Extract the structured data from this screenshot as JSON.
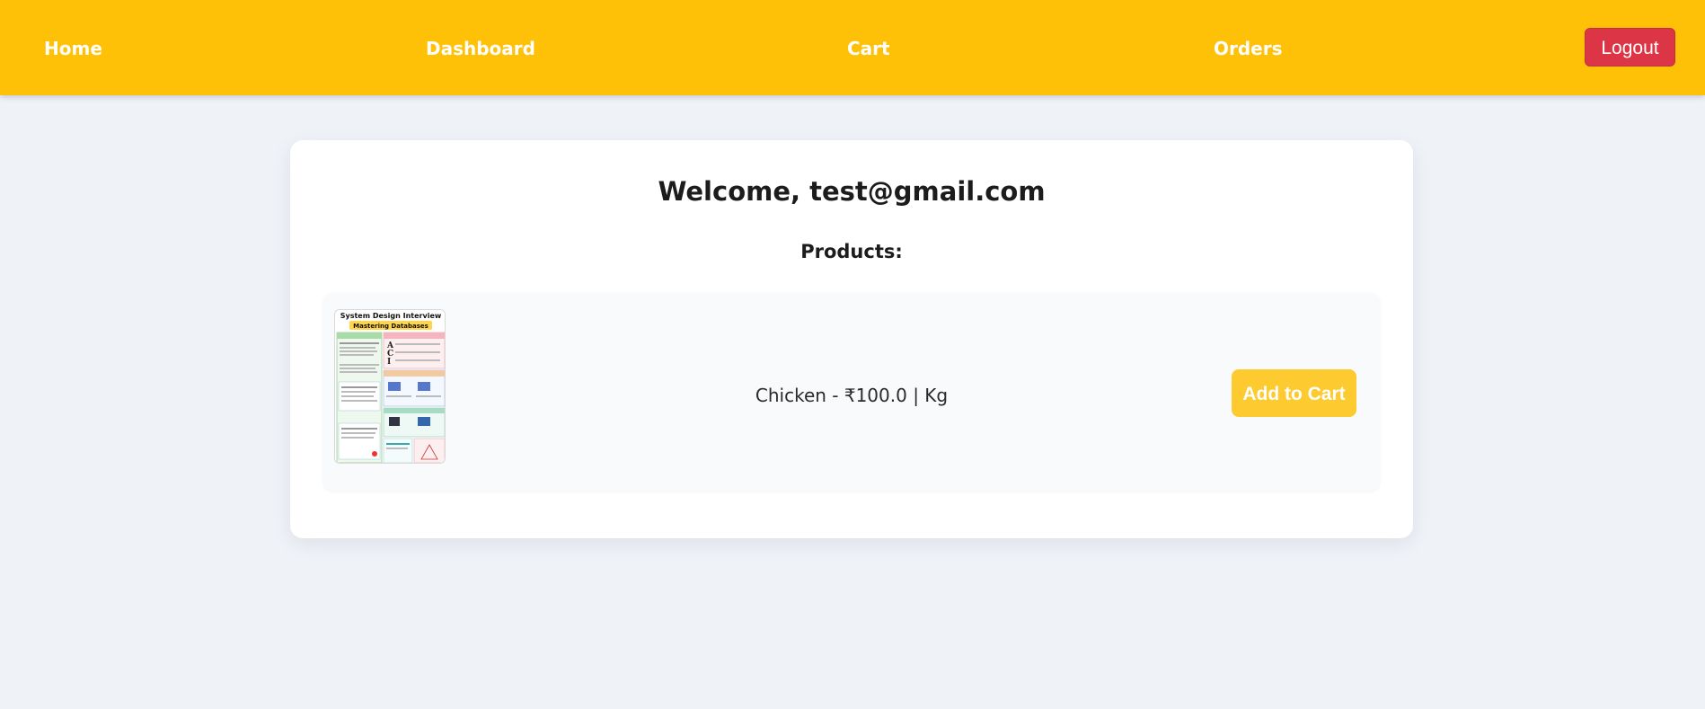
{
  "nav": {
    "home": "Home",
    "dashboard": "Dashboard",
    "cart": "Cart",
    "orders": "Orders",
    "logout": "Logout"
  },
  "main": {
    "welcome": "Welcome, test@gmail.com",
    "products_heading": "Products:"
  },
  "products": [
    {
      "name": "Chicken",
      "price": "₹100.0",
      "unit": "Kg",
      "add_button": "Add to Cart",
      "image_title": "System Design Interview",
      "image_subtitle": "Mastering Databases"
    }
  ],
  "colors": {
    "navbar": "#ffc107",
    "logout": "#dc3545",
    "add_to_cart": "#fdca30",
    "background": "#eff2f7"
  }
}
